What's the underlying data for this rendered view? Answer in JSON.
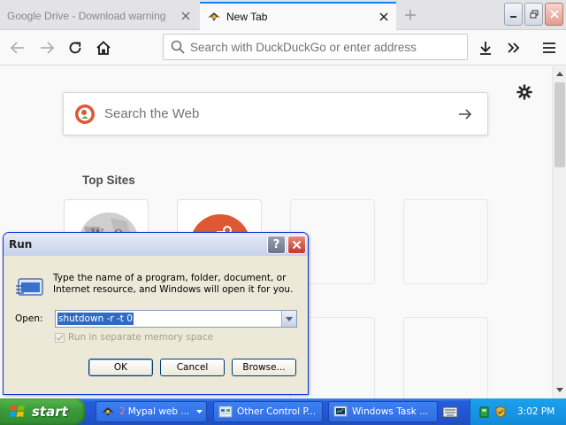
{
  "browser": {
    "tabs": [
      {
        "title": "Google Drive - Download warning",
        "active": false
      },
      {
        "title": "New Tab",
        "active": true
      }
    ],
    "urlbar": {
      "placeholder": "Search with DuckDuckGo or enter address"
    }
  },
  "newtab": {
    "search_placeholder": "Search the Web",
    "top_sites_title": "Top Sites"
  },
  "run_dialog": {
    "title": "Run",
    "help_glyph": "?",
    "description": "Type the name of a program, folder, document, or Internet resource, and Windows will open it for you.",
    "open_label": "Open:",
    "open_value": "shutdown -r -t 0",
    "memory_checkbox_label": "Run in separate memory space",
    "ok_label": "OK",
    "cancel_label": "Cancel",
    "browse_label": "Browse..."
  },
  "taskbar": {
    "start_label": "start",
    "tasks": [
      {
        "count": "2",
        "label": "Mypal web ...",
        "icon": "mypal-icon"
      },
      {
        "label": "Other Control P...",
        "icon": "control-panel-icon"
      },
      {
        "label": "Windows Task ...",
        "icon": "task-manager-icon"
      }
    ],
    "clock": "3:02 PM"
  },
  "colors": {
    "accent": "#0a84ff",
    "xp_taskbar": "#245edb",
    "xp_start": "#3c9d3c",
    "ddg_orange": "#de5833",
    "selection": "#316ac5"
  }
}
